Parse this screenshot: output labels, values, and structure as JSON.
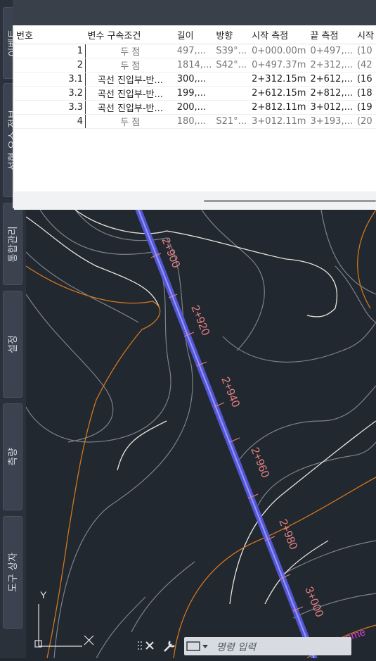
{
  "side_tabs": [
    {
      "label": "이벤트"
    },
    {
      "label": "선형 요소 정보"
    },
    {
      "label": "통합관리"
    },
    {
      "label": "설정"
    },
    {
      "label": "측량"
    },
    {
      "label": "도구 상자"
    }
  ],
  "table": {
    "headers": [
      "번호",
      "변수 구속조건",
      "길이",
      "방향",
      "시작 측점",
      "끝 측점",
      "시작"
    ],
    "rows": [
      [
        "1",
        "두 점",
        "497,...",
        "S39°...",
        "0+000.00m",
        "0+497,...",
        "(10"
      ],
      [
        "2",
        "두 점",
        "1814,...",
        "S42°...",
        "0+497.37m",
        "2+312,...",
        "(42"
      ],
      [
        "3.1",
        "곡선 진입부-반...",
        "300,...",
        "",
        "2+312.15m",
        "2+612,...",
        "(16"
      ],
      [
        "3.2",
        "곡선 진입부-반...",
        "199,...",
        "",
        "2+612.15m",
        "2+812,...",
        "(18"
      ],
      [
        "3.3",
        "곡선 진입부-반...",
        "200,...",
        "",
        "2+812.11m",
        "3+012,...",
        "(19"
      ],
      [
        "4",
        "두 점",
        "180,...",
        "S21°...",
        "3+012.11m",
        "3+193,...",
        "(20"
      ]
    ]
  },
  "drawing": {
    "stations": [
      "2+900",
      "2+920",
      "2+940",
      "2+960",
      "2+980",
      "3+000"
    ],
    "alignment_label": "Alignme",
    "ucs_y": "Y",
    "colors": {
      "alignment": "#5a5ae6",
      "station_text": "#e88080",
      "contour_major": "#d4761c",
      "contour_minor": "#8a8d92",
      "alignment_label": "#d040d0"
    }
  },
  "command_line": {
    "placeholder": "명령 입력"
  }
}
